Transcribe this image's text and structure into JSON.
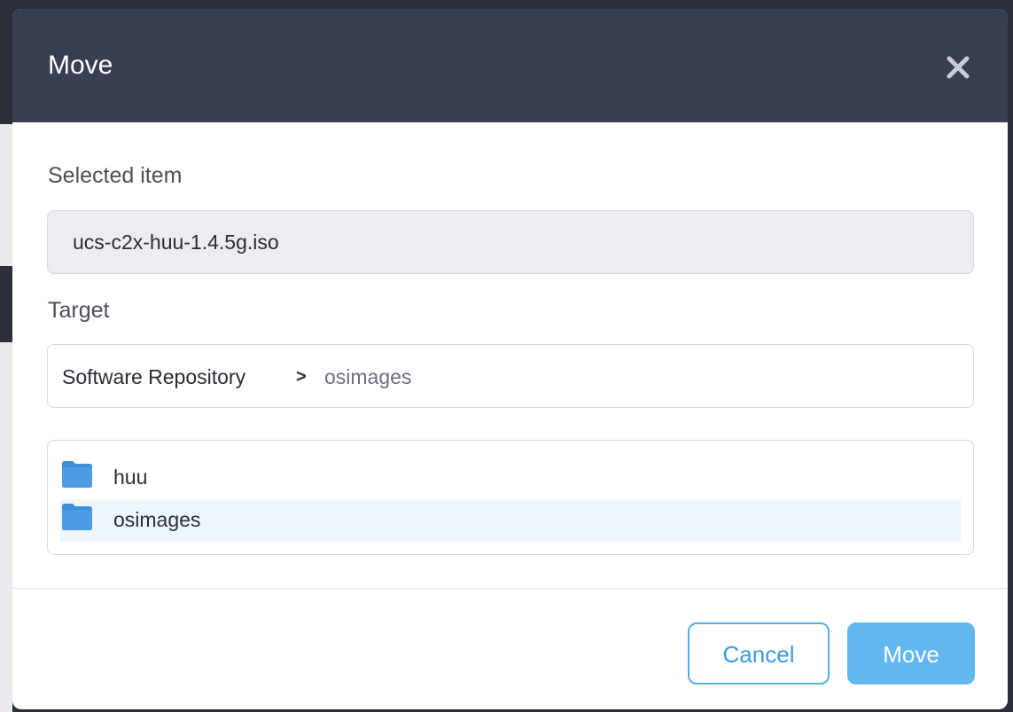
{
  "dialog": {
    "title": "Move",
    "close_icon": "close-icon"
  },
  "selected": {
    "label": "Selected item",
    "value": "ucs-c2x-huu-1.4.5g.iso"
  },
  "target": {
    "label": "Target",
    "breadcrumb": {
      "root": "Software Repository",
      "separator": ">",
      "current": "osimages"
    }
  },
  "folders": [
    {
      "name": "huu",
      "icon": "folder-icon",
      "selected": false
    },
    {
      "name": "osimages",
      "icon": "folder-icon",
      "selected": true
    }
  ],
  "footer": {
    "cancel_label": "Cancel",
    "move_label": "Move"
  },
  "colors": {
    "header_bg": "#393e51",
    "accent": "#62b7ef",
    "folder": "#3f8fd8",
    "selected_row": "#eef5fc"
  }
}
